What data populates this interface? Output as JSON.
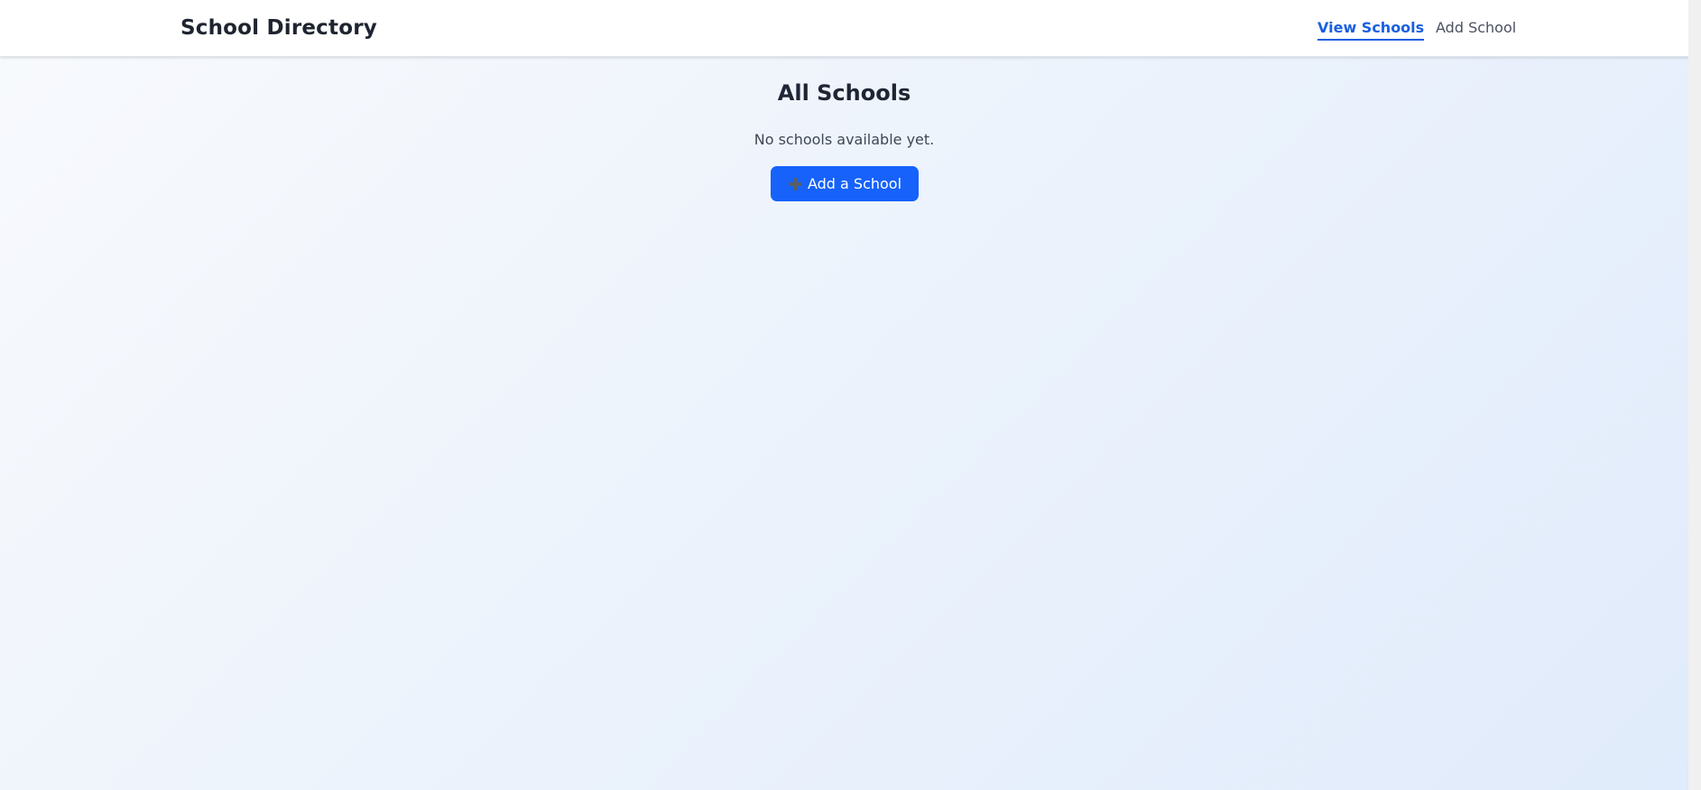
{
  "header": {
    "brand": "School Directory",
    "nav": [
      {
        "label": "View Schools",
        "active": true
      },
      {
        "label": "Add School",
        "active": false
      }
    ]
  },
  "main": {
    "title": "All Schools",
    "empty_message": "No schools available yet.",
    "add_button": {
      "icon": "plus-icon",
      "label": "Add a School"
    }
  },
  "colors": {
    "accent": "#1662fb",
    "active_link": "#1a5fe0",
    "background_start": "#f8fafd",
    "background_end": "#e0ebfb"
  }
}
